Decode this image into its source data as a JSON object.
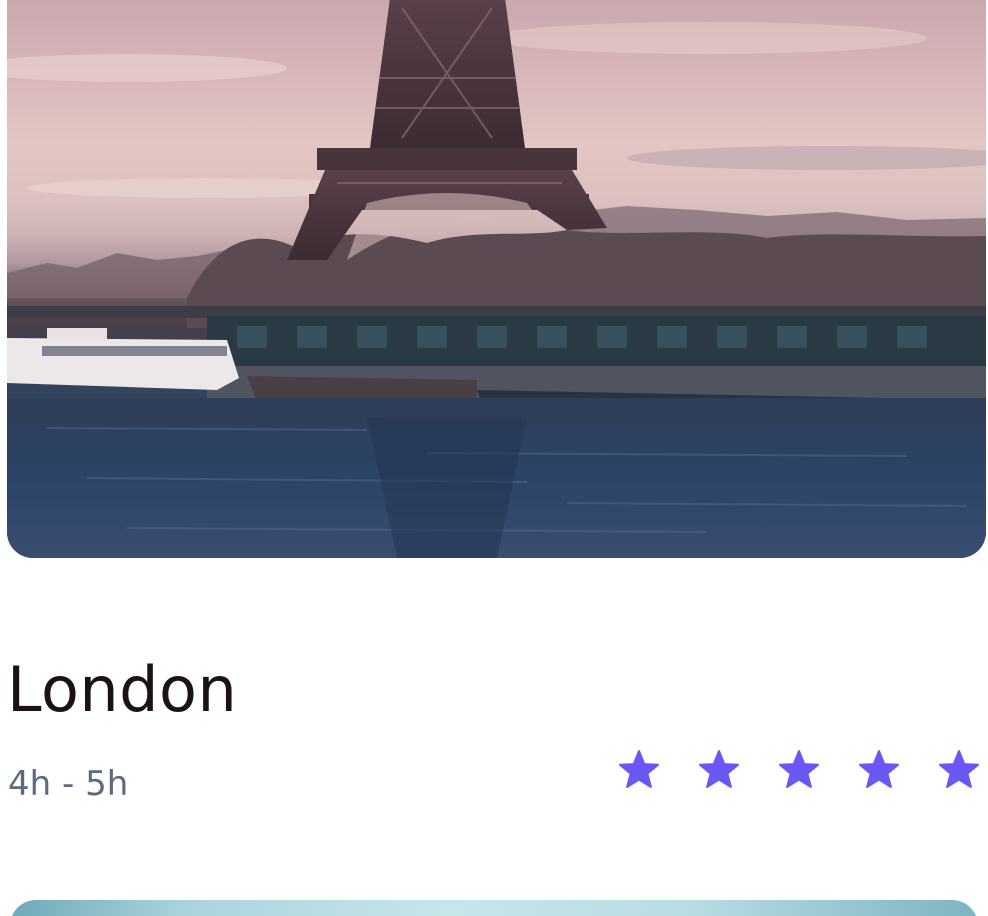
{
  "card": {
    "city": "London",
    "duration": "4h - 5h",
    "rating": {
      "value": 5,
      "max": 5,
      "star_color": "#6a57f5"
    }
  },
  "colors": {
    "title": "#1b1218",
    "subtitle": "#5b6b7d",
    "accent": "#6a57f5"
  }
}
